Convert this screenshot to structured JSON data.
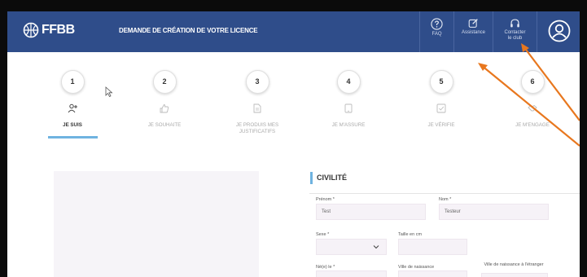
{
  "header": {
    "logo_text": "FFBB",
    "title": "DEMANDE DE CRÉATION DE VOTRE LICENCE",
    "nav": {
      "faq": "FAQ",
      "assistance": "Assistance",
      "contact_line1": "Contacter",
      "contact_line2": "le club"
    },
    "brand_color": "#2f4d8a"
  },
  "steps": [
    {
      "number": "1",
      "label": "JE SUIS",
      "icon": "user-add-icon",
      "active": true
    },
    {
      "number": "2",
      "label": "JE SOUHAITE",
      "icon": "thumbs-up-icon",
      "active": false
    },
    {
      "number": "3",
      "label": "JE PRODUIS MES JUSTIFICATIFS",
      "icon": "document-icon",
      "active": false
    },
    {
      "number": "4",
      "label": "JE M'ASSURE",
      "icon": "tablet-icon",
      "active": false
    },
    {
      "number": "5",
      "label": "JE VÉRIFIE",
      "icon": "check-square-icon",
      "active": false
    },
    {
      "number": "6",
      "label": "JE M'ENGAGE",
      "icon": "handshake-icon",
      "active": false
    }
  ],
  "form": {
    "section_title": "CIVILITÉ",
    "prenom_label": "Prénom *",
    "prenom_value": "Test",
    "nom_label": "Nom *",
    "nom_value": "Testeur",
    "sexe_label": "Sexe *",
    "taille_label": "Taille en cm",
    "ne_label": "Né(e) le *",
    "ville_label": "Ville de naissance",
    "ville_etranger_label": "Ville de naissance à l'étranger"
  },
  "accent_color": "#6fb3e0",
  "annotation_color": "#e8771e"
}
